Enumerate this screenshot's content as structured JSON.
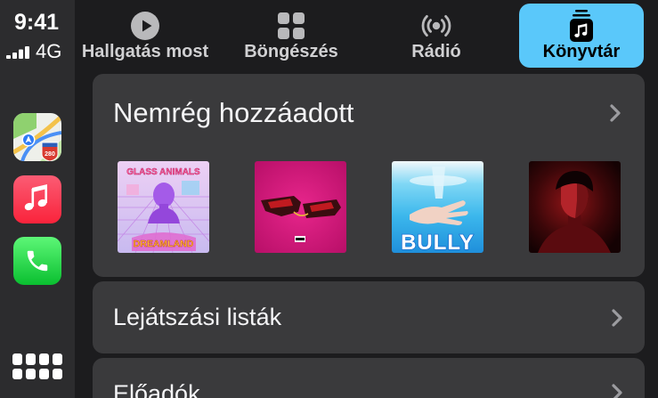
{
  "status": {
    "time": "9:41",
    "network": "4G",
    "signal_bars": 4
  },
  "sidebar": {
    "apps": [
      {
        "icon": "maps-icon",
        "shield_text": "280"
      },
      {
        "icon": "music-icon"
      },
      {
        "icon": "phone-icon"
      }
    ],
    "launcher_icon": "app-grid-icon"
  },
  "tabs": [
    {
      "label": "Hallgatás most",
      "icon": "play-circle-icon",
      "selected": false
    },
    {
      "label": "Böngészés",
      "icon": "grid-icon",
      "selected": false
    },
    {
      "label": "Rádió",
      "icon": "radio-waves-icon",
      "selected": false
    },
    {
      "label": "Könyvtár",
      "icon": "music-library-icon",
      "selected": true
    }
  ],
  "library": {
    "recently_added": {
      "title": "Nemrég hozzáadott",
      "albums": [
        {
          "cover_text_top": "GLASS ANIMALS",
          "cover_text_bottom": "DREAMLAND"
        },
        {},
        {
          "cover_text_bottom": "BULLY"
        },
        {}
      ]
    },
    "rows": [
      {
        "label": "Lejátszási listák",
        "icon": "chevron-right-icon"
      },
      {
        "label": "Előadók",
        "icon": "chevron-right-icon"
      }
    ]
  },
  "colors": {
    "accent": "#5AC8FA",
    "background": "#1C1C1E",
    "card": "#3A3A3C"
  }
}
